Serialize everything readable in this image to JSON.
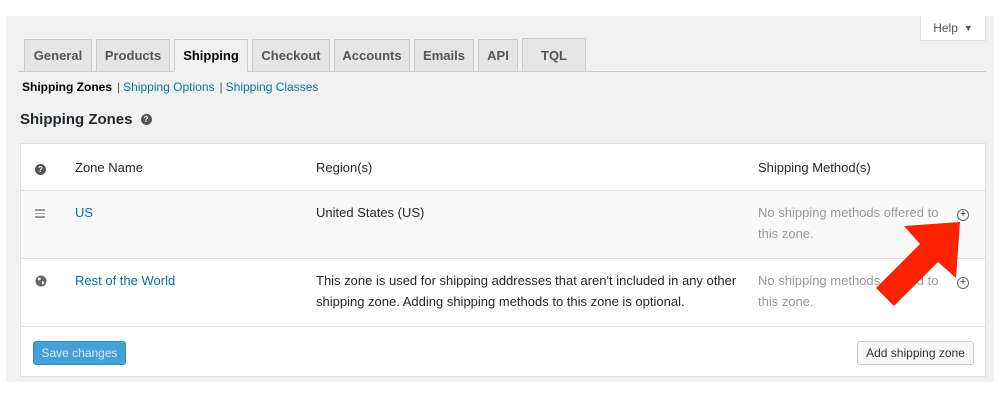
{
  "help": {
    "label": "Help",
    "caret": "▼"
  },
  "tabs": [
    {
      "label": "General"
    },
    {
      "label": "Products"
    },
    {
      "label": "Shipping"
    },
    {
      "label": "Checkout"
    },
    {
      "label": "Accounts"
    },
    {
      "label": "Emails"
    },
    {
      "label": "API"
    },
    {
      "label": "TQL"
    }
  ],
  "active_tab": "Shipping",
  "subnav": {
    "current": "Shipping Zones",
    "sep": "|",
    "links": [
      "Shipping Options",
      "Shipping Classes"
    ]
  },
  "section": {
    "title": "Shipping Zones",
    "help_icon": "question-circle-icon"
  },
  "table": {
    "headers": {
      "icon": "?",
      "name": "Zone Name",
      "region": "Region(s)",
      "method": "Shipping Method(s)"
    },
    "rows": [
      {
        "icon": "drag-handle-icon",
        "name": "US",
        "region": "United States (US)",
        "method": "No shipping methods offered to this zone."
      },
      {
        "icon": "globe-icon",
        "name": "Rest of the World",
        "region": "This zone is used for shipping addresses that aren't included in any other shipping zone. Adding shipping methods to this zone is optional.",
        "method": "No shipping methods offered to this zone."
      }
    ]
  },
  "buttons": {
    "save": "Save changes",
    "add_zone": "Add shipping zone"
  },
  "colors": {
    "link": "#0073aa",
    "primary_button": "#47a0d4",
    "arrow": "#ff2200"
  }
}
